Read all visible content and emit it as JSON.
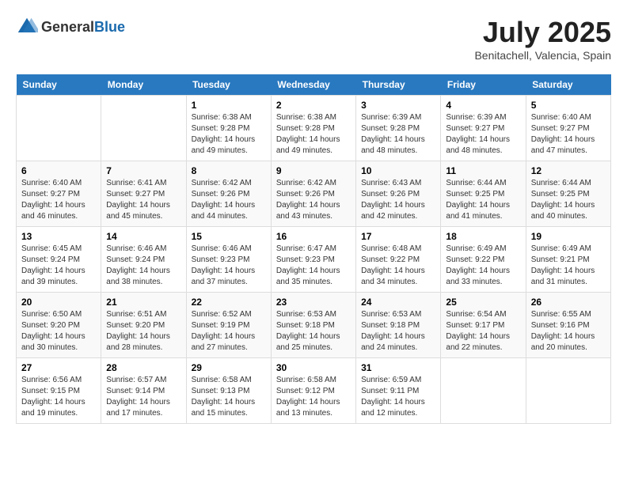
{
  "header": {
    "logo_general": "General",
    "logo_blue": "Blue",
    "month": "July 2025",
    "location": "Benitachell, Valencia, Spain"
  },
  "weekdays": [
    "Sunday",
    "Monday",
    "Tuesday",
    "Wednesday",
    "Thursday",
    "Friday",
    "Saturday"
  ],
  "weeks": [
    [
      {
        "day": "",
        "content": ""
      },
      {
        "day": "",
        "content": ""
      },
      {
        "day": "1",
        "content": "Sunrise: 6:38 AM\nSunset: 9:28 PM\nDaylight: 14 hours and 49 minutes."
      },
      {
        "day": "2",
        "content": "Sunrise: 6:38 AM\nSunset: 9:28 PM\nDaylight: 14 hours and 49 minutes."
      },
      {
        "day": "3",
        "content": "Sunrise: 6:39 AM\nSunset: 9:28 PM\nDaylight: 14 hours and 48 minutes."
      },
      {
        "day": "4",
        "content": "Sunrise: 6:39 AM\nSunset: 9:27 PM\nDaylight: 14 hours and 48 minutes."
      },
      {
        "day": "5",
        "content": "Sunrise: 6:40 AM\nSunset: 9:27 PM\nDaylight: 14 hours and 47 minutes."
      }
    ],
    [
      {
        "day": "6",
        "content": "Sunrise: 6:40 AM\nSunset: 9:27 PM\nDaylight: 14 hours and 46 minutes."
      },
      {
        "day": "7",
        "content": "Sunrise: 6:41 AM\nSunset: 9:27 PM\nDaylight: 14 hours and 45 minutes."
      },
      {
        "day": "8",
        "content": "Sunrise: 6:42 AM\nSunset: 9:26 PM\nDaylight: 14 hours and 44 minutes."
      },
      {
        "day": "9",
        "content": "Sunrise: 6:42 AM\nSunset: 9:26 PM\nDaylight: 14 hours and 43 minutes."
      },
      {
        "day": "10",
        "content": "Sunrise: 6:43 AM\nSunset: 9:26 PM\nDaylight: 14 hours and 42 minutes."
      },
      {
        "day": "11",
        "content": "Sunrise: 6:44 AM\nSunset: 9:25 PM\nDaylight: 14 hours and 41 minutes."
      },
      {
        "day": "12",
        "content": "Sunrise: 6:44 AM\nSunset: 9:25 PM\nDaylight: 14 hours and 40 minutes."
      }
    ],
    [
      {
        "day": "13",
        "content": "Sunrise: 6:45 AM\nSunset: 9:24 PM\nDaylight: 14 hours and 39 minutes."
      },
      {
        "day": "14",
        "content": "Sunrise: 6:46 AM\nSunset: 9:24 PM\nDaylight: 14 hours and 38 minutes."
      },
      {
        "day": "15",
        "content": "Sunrise: 6:46 AM\nSunset: 9:23 PM\nDaylight: 14 hours and 37 minutes."
      },
      {
        "day": "16",
        "content": "Sunrise: 6:47 AM\nSunset: 9:23 PM\nDaylight: 14 hours and 35 minutes."
      },
      {
        "day": "17",
        "content": "Sunrise: 6:48 AM\nSunset: 9:22 PM\nDaylight: 14 hours and 34 minutes."
      },
      {
        "day": "18",
        "content": "Sunrise: 6:49 AM\nSunset: 9:22 PM\nDaylight: 14 hours and 33 minutes."
      },
      {
        "day": "19",
        "content": "Sunrise: 6:49 AM\nSunset: 9:21 PM\nDaylight: 14 hours and 31 minutes."
      }
    ],
    [
      {
        "day": "20",
        "content": "Sunrise: 6:50 AM\nSunset: 9:20 PM\nDaylight: 14 hours and 30 minutes."
      },
      {
        "day": "21",
        "content": "Sunrise: 6:51 AM\nSunset: 9:20 PM\nDaylight: 14 hours and 28 minutes."
      },
      {
        "day": "22",
        "content": "Sunrise: 6:52 AM\nSunset: 9:19 PM\nDaylight: 14 hours and 27 minutes."
      },
      {
        "day": "23",
        "content": "Sunrise: 6:53 AM\nSunset: 9:18 PM\nDaylight: 14 hours and 25 minutes."
      },
      {
        "day": "24",
        "content": "Sunrise: 6:53 AM\nSunset: 9:18 PM\nDaylight: 14 hours and 24 minutes."
      },
      {
        "day": "25",
        "content": "Sunrise: 6:54 AM\nSunset: 9:17 PM\nDaylight: 14 hours and 22 minutes."
      },
      {
        "day": "26",
        "content": "Sunrise: 6:55 AM\nSunset: 9:16 PM\nDaylight: 14 hours and 20 minutes."
      }
    ],
    [
      {
        "day": "27",
        "content": "Sunrise: 6:56 AM\nSunset: 9:15 PM\nDaylight: 14 hours and 19 minutes."
      },
      {
        "day": "28",
        "content": "Sunrise: 6:57 AM\nSunset: 9:14 PM\nDaylight: 14 hours and 17 minutes."
      },
      {
        "day": "29",
        "content": "Sunrise: 6:58 AM\nSunset: 9:13 PM\nDaylight: 14 hours and 15 minutes."
      },
      {
        "day": "30",
        "content": "Sunrise: 6:58 AM\nSunset: 9:12 PM\nDaylight: 14 hours and 13 minutes."
      },
      {
        "day": "31",
        "content": "Sunrise: 6:59 AM\nSunset: 9:11 PM\nDaylight: 14 hours and 12 minutes."
      },
      {
        "day": "",
        "content": ""
      },
      {
        "day": "",
        "content": ""
      }
    ]
  ]
}
